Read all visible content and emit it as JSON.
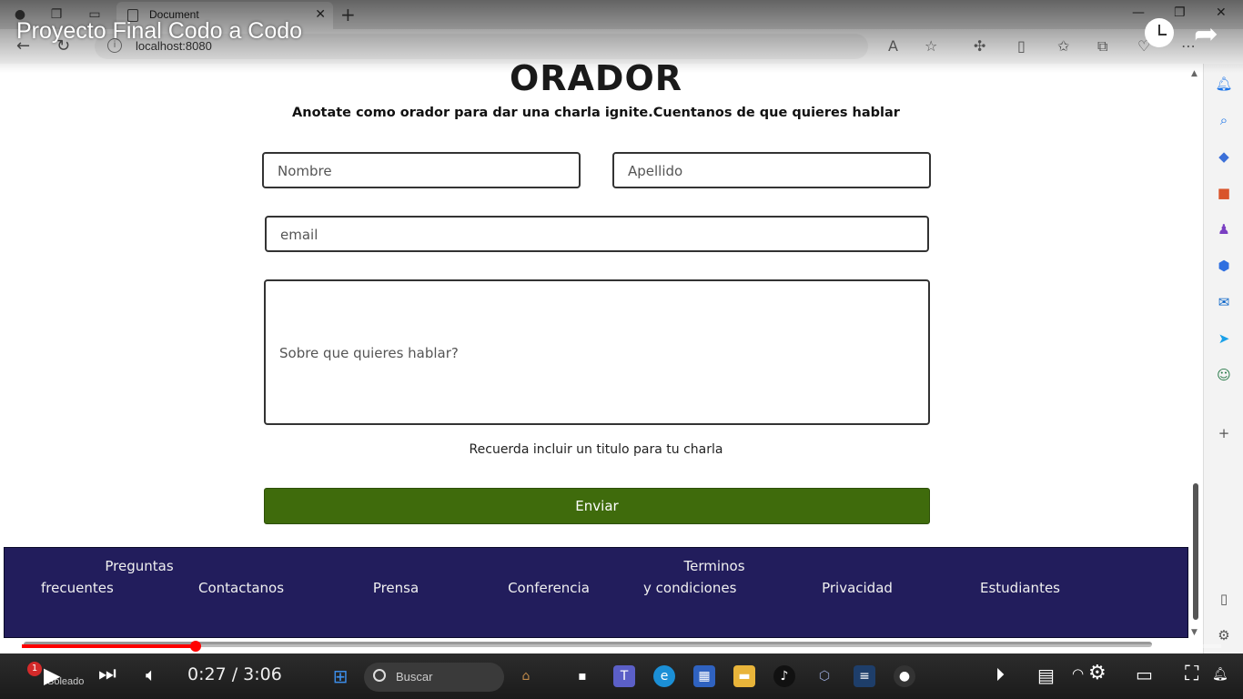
{
  "browser": {
    "tab_title": "Document",
    "url": "localhost:8080"
  },
  "video": {
    "title": "Proyecto Final Codo a Codo",
    "time": "0:27 / 3:06",
    "progress_fraction": 0.145
  },
  "page": {
    "heading": "ORADOR",
    "subtitle": "Anotate como orador para dar una charla ignite.Cuentanos de que quieres hablar",
    "form": {
      "nombre_placeholder": "Nombre",
      "apellido_placeholder": "Apellido",
      "email_placeholder": "email",
      "topic_placeholder": "Sobre que quieres hablar?",
      "reminder": "Recuerda incluir un titulo para tu charla",
      "submit_label": "Enviar"
    },
    "footer": {
      "links": [
        {
          "line1": "Preguntas",
          "line2": "frecuentes"
        },
        {
          "line1": "Contactanos"
        },
        {
          "line1": "Prensa"
        },
        {
          "line1": "Conferencia"
        },
        {
          "line1": "Terminos",
          "line2": "y condiciones"
        },
        {
          "line1": "Privacidad"
        },
        {
          "line1": "Estudiantes"
        }
      ]
    }
  },
  "taskbar": {
    "search_label": "Buscar",
    "weather_badge": "1",
    "weather_text": "Soleado"
  },
  "colors": {
    "submit_bg": "#3f6b0c",
    "footer_bg": "#221d5c",
    "progress": "#ff0000"
  }
}
